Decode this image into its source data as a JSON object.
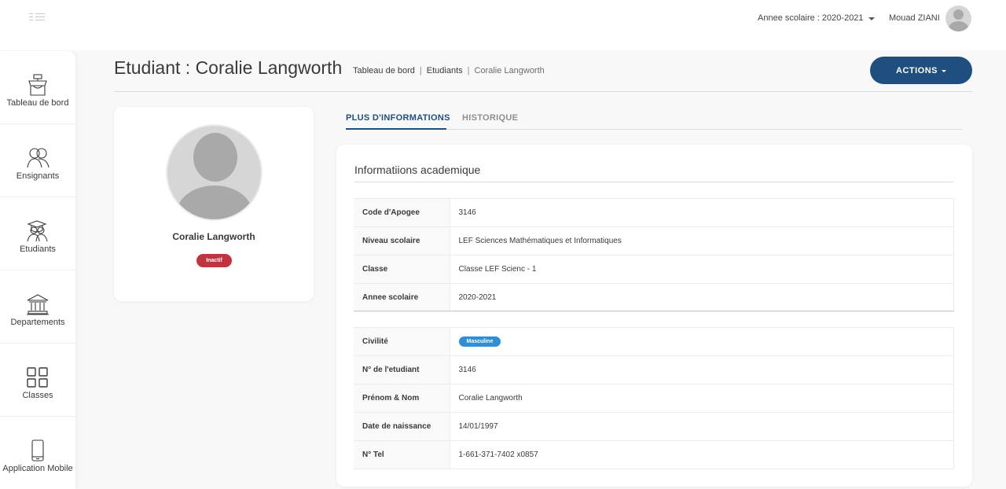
{
  "header": {
    "school_year_label": "Annee scolaire : 2020-2021",
    "user_name": "Mouad ZIANI"
  },
  "sidebar": {
    "items": [
      {
        "label": "Tableau de bord",
        "icon": "dashboard-icon"
      },
      {
        "label": "Ensignants",
        "icon": "teachers-icon"
      },
      {
        "label": "Etudiants",
        "icon": "students-icon"
      },
      {
        "label": "Departements",
        "icon": "building-icon"
      },
      {
        "label": "Classes",
        "icon": "grid-icon"
      },
      {
        "label": "Application Mobile",
        "icon": "mobile-icon"
      }
    ]
  },
  "page": {
    "title": "Etudiant : Coralie Langworth",
    "breadcrumb": [
      "Tableau de bord",
      "Etudiants",
      "Coralie Langworth"
    ],
    "actions_label": "ACTIONS"
  },
  "profile": {
    "name": "Coralie Langworth",
    "status": "Inactif"
  },
  "tabs": [
    "PLUS D'INFORMATIONS",
    "HISTORIQUE"
  ],
  "academic": {
    "title": "Informatiions academique",
    "rows": [
      {
        "label": "Code d'Apogee",
        "value": "3146"
      },
      {
        "label": "Niveau scolaire",
        "value": "LEF Sciences Mathématiques et Informatiques"
      },
      {
        "label": "Classe",
        "value": "Classe LEF Scienc - 1"
      },
      {
        "label": "Annee scolaire",
        "value": "2020-2021"
      }
    ]
  },
  "personal": {
    "rows": [
      {
        "label": "Civilité",
        "value": "Masculine"
      },
      {
        "label": "N° de l'etudiant",
        "value": "3146"
      },
      {
        "label": "Prénom & Nom",
        "value": "Coralie Langworth"
      },
      {
        "label": "Date de naissance",
        "value": "14/01/1997"
      },
      {
        "label": "N° Tel",
        "value": "1-661-371-7402 x0857"
      }
    ]
  },
  "colors": {
    "primary": "#1e4f7e",
    "inactive_badge": "#c0343f",
    "gender_badge": "#2f8ed8"
  }
}
